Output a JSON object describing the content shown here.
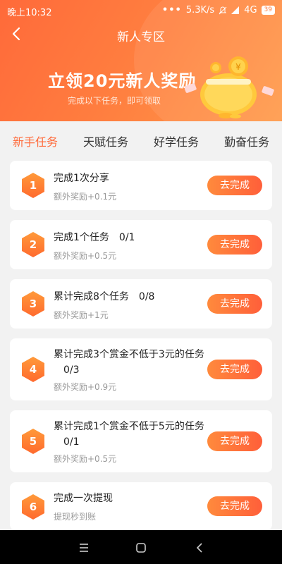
{
  "status_bar": {
    "time": "晚上10:32",
    "dots": "•••",
    "speed": "5.3K/s",
    "network": "4G",
    "battery": "39"
  },
  "nav": {
    "back_icon": "chevron-left-icon",
    "title": "新人专区"
  },
  "banner": {
    "title": "立领20元新人奖励",
    "subtitle": "完成以下任务，即可领取",
    "image": "piggy-bank-coins"
  },
  "tabs": [
    {
      "label": "新手任务",
      "active": true
    },
    {
      "label": "天赋任务",
      "active": false
    },
    {
      "label": "好学任务",
      "active": false
    },
    {
      "label": "勤奋任务",
      "active": false
    }
  ],
  "tasks": [
    {
      "num": "1",
      "title": "完成1次分享",
      "progress": "",
      "reward": "额外奖励+0.1元",
      "button": "去完成"
    },
    {
      "num": "2",
      "title": "完成1个任务",
      "progress": "0/1",
      "reward": "额外奖励+0.5元",
      "button": "去完成"
    },
    {
      "num": "3",
      "title": "累计完成8个任务",
      "progress": "0/8",
      "reward": "额外奖励+1元",
      "button": "去完成"
    },
    {
      "num": "4",
      "title": "累计完成3个赏金不低于3元的任务",
      "progress": "0/3",
      "reward": "额外奖励+0.9元",
      "button": "去完成"
    },
    {
      "num": "5",
      "title": "累计完成1个赏金不低于5元的任务",
      "progress": "0/1",
      "reward": "额外奖励+0.5元",
      "button": "去完成"
    },
    {
      "num": "6",
      "title": "完成一次提现",
      "progress": "",
      "reward": "提现秒到账",
      "button": "去完成"
    }
  ],
  "colors": {
    "accent": "#ff6a3a",
    "button_start": "#ff8a3c",
    "button_end": "#ff5f3a",
    "hex_top": "#ff9a3a",
    "hex_bottom": "#ff6a2e"
  },
  "system_nav": {
    "menu_icon": "menu-icon",
    "home_icon": "home-icon",
    "back_icon": "back-icon"
  }
}
